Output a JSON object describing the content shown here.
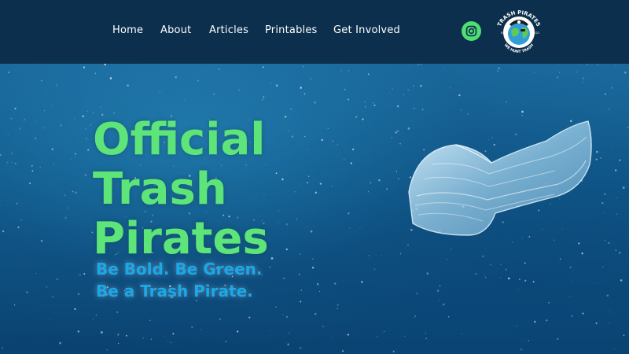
{
  "nav": {
    "items": [
      {
        "label": "Home"
      },
      {
        "label": "About"
      },
      {
        "label": "Articles"
      },
      {
        "label": "Printables"
      },
      {
        "label": "Get Involved"
      }
    ]
  },
  "social": {
    "icon": "instagram-icon"
  },
  "logo": {
    "top_text": "TRASH PIRATES",
    "bottom_text": "WE HUNT TRASH",
    "est_label": "EST.",
    "year": "2021"
  },
  "hero": {
    "title_lines": [
      "Official",
      "Trash",
      "Pirates"
    ],
    "tagline_lines": [
      "Be Bold. Be Green.",
      "Be a Trash Pirate."
    ]
  },
  "colors": {
    "header_bg": "#0b2f4c",
    "title_green": "#5ee57a",
    "tagline_blue": "#1aa8e8",
    "instagram_bg": "#4fde72"
  }
}
